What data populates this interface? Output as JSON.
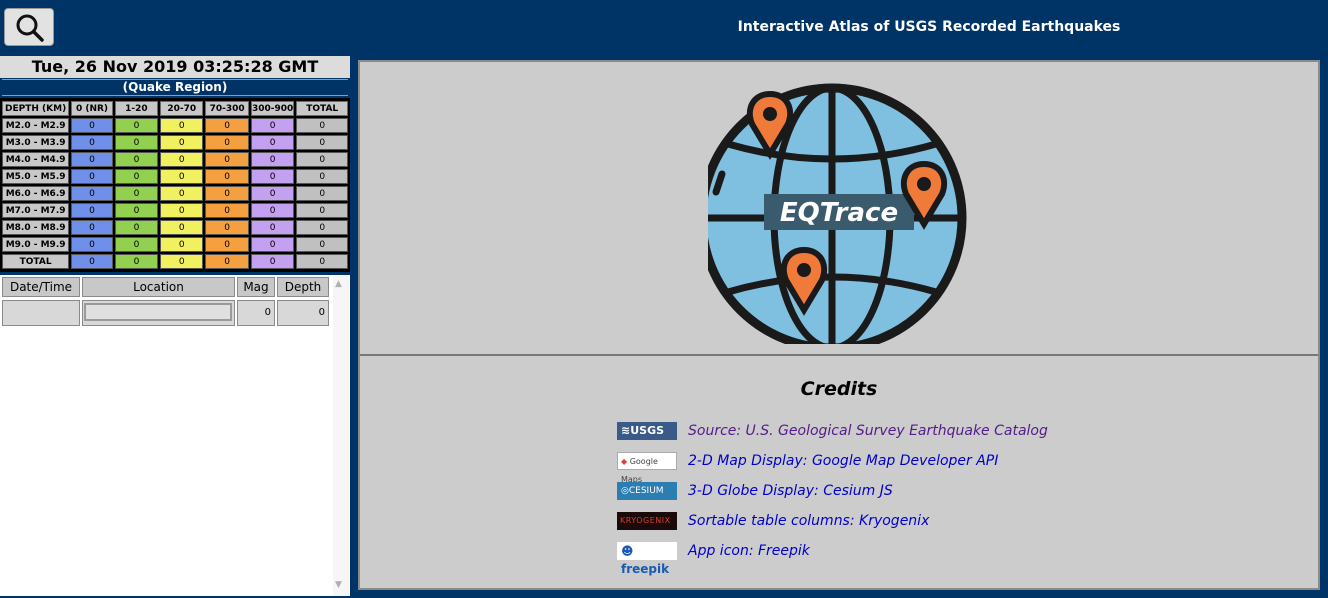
{
  "header": {
    "title": "Interactive Atlas of USGS Recorded Earthquakes",
    "search_icon": "magnifier-icon"
  },
  "status": {
    "datetime": "Tue, 26 Nov 2019 03:25:28 GMT",
    "region": "(Quake Region)"
  },
  "mag_table": {
    "headers": [
      "DEPTH (KM)",
      "0 (NR)",
      "1-20",
      "20-70",
      "70-300",
      "300-900",
      "TOTAL"
    ],
    "rows": [
      {
        "label": "M2.0 - M2.9",
        "values": [
          "0",
          "0",
          "0",
          "0",
          "0",
          "0"
        ]
      },
      {
        "label": "M3.0 - M3.9",
        "values": [
          "0",
          "0",
          "0",
          "0",
          "0",
          "0"
        ]
      },
      {
        "label": "M4.0 - M4.9",
        "values": [
          "0",
          "0",
          "0",
          "0",
          "0",
          "0"
        ]
      },
      {
        "label": "M5.0 - M5.9",
        "values": [
          "0",
          "0",
          "0",
          "0",
          "0",
          "0"
        ]
      },
      {
        "label": "M6.0 - M6.9",
        "values": [
          "0",
          "0",
          "0",
          "0",
          "0",
          "0"
        ]
      },
      {
        "label": "M7.0 - M7.9",
        "values": [
          "0",
          "0",
          "0",
          "0",
          "0",
          "0"
        ]
      },
      {
        "label": "M8.0 - M8.9",
        "values": [
          "0",
          "0",
          "0",
          "0",
          "0",
          "0"
        ]
      },
      {
        "label": "M9.0 - M9.9",
        "values": [
          "0",
          "0",
          "0",
          "0",
          "0",
          "0"
        ]
      },
      {
        "label": "TOTAL",
        "values": [
          "0",
          "0",
          "0",
          "0",
          "0",
          "0"
        ]
      }
    ],
    "depth_colors": [
      "#6f8fe8",
      "#92d050",
      "#f0f060",
      "#f4a040",
      "#c4a0f0",
      "#c0c0c0"
    ]
  },
  "quake_list": {
    "headers": {
      "datetime": "Date/Time",
      "location": "Location",
      "mag": "Mag",
      "depth": "Depth"
    },
    "row": {
      "mag": "0",
      "depth": "0"
    }
  },
  "logo": {
    "text": "EQTrace",
    "globe_color": "#7fbfe0",
    "pin_color": "#f07a3a"
  },
  "credits": {
    "title": "Credits",
    "items": [
      {
        "logo_text": "USGS",
        "logo_icon": "usgs-logo-icon",
        "link": "Source: U.S. Geological Survey Earthquake Catalog"
      },
      {
        "logo_text": "Google Maps",
        "logo_icon": "google-maps-logo-icon",
        "link": "2-D Map Display: Google Map Developer API"
      },
      {
        "logo_text": "CESIUM",
        "logo_icon": "cesium-logo-icon",
        "link": "3-D Globe Display: Cesium JS"
      },
      {
        "logo_text": "KRYOGENIX",
        "logo_icon": "kryogenix-logo-icon",
        "link": "Sortable table columns: Kryogenix"
      },
      {
        "logo_text": "freepik",
        "logo_icon": "freepik-logo-icon",
        "link": "App icon: Freepik"
      }
    ]
  }
}
